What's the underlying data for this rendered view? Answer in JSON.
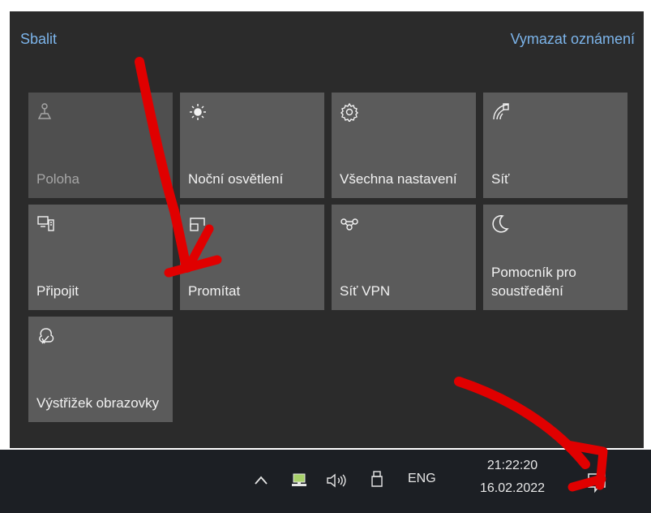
{
  "action_center": {
    "collapse_label": "Sbalit",
    "clear_label": "Vymazat oznámení",
    "tiles": [
      {
        "label": "Poloha",
        "icon": "location-icon",
        "state": "disabled"
      },
      {
        "label": "Noční osvětlení",
        "icon": "night-light-icon",
        "state": "normal"
      },
      {
        "label": "Všechna nastavení",
        "icon": "settings-gear-icon",
        "state": "normal"
      },
      {
        "label": "Síť",
        "icon": "network-icon",
        "state": "normal"
      },
      {
        "label": "Připojit",
        "icon": "connect-icon",
        "state": "normal"
      },
      {
        "label": "Promítat",
        "icon": "project-icon",
        "state": "normal"
      },
      {
        "label": "Síť VPN",
        "icon": "vpn-icon",
        "state": "normal"
      },
      {
        "label": "Pomocník pro soustředění",
        "icon": "focus-assist-moon-icon",
        "state": "normal"
      },
      {
        "label": "Výstřižek obrazovky",
        "icon": "screen-snip-icon",
        "state": "normal"
      }
    ]
  },
  "taskbar": {
    "language": "ENG",
    "time": "21:22:20",
    "date": "16.02.2022",
    "tray_icons": [
      "chevron-up-icon",
      "network-monitor-icon",
      "speaker-icon",
      "usb-drive-icon"
    ],
    "notification_icon": "notification-icon"
  },
  "colors": {
    "panel_bg": "#2b2b2b",
    "tile_bg": "#5b5b5b",
    "link": "#7cb4ea",
    "taskbar_bg": "#1c1f24",
    "annotation": "#e00000"
  }
}
